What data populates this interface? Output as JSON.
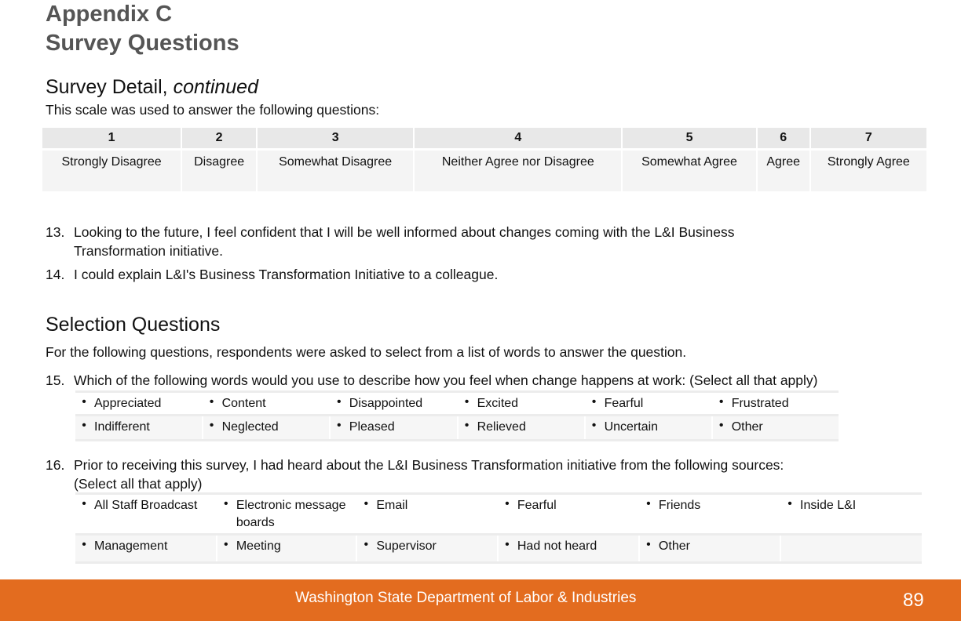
{
  "header": {
    "appendix": "Appendix C",
    "title": "Survey Questions"
  },
  "survey_detail": {
    "heading": "Survey Detail, ",
    "heading_italic": "continued",
    "intro": "This scale was used to answer the following questions:"
  },
  "scale": [
    {
      "value": "1",
      "label": "Strongly Disagree"
    },
    {
      "value": "2",
      "label": "Disagree"
    },
    {
      "value": "3",
      "label": "Somewhat Disagree"
    },
    {
      "value": "4",
      "label": "Neither Agree nor Disagree"
    },
    {
      "value": "5",
      "label": "Somewhat Agree"
    },
    {
      "value": "6",
      "label": "Agree"
    },
    {
      "value": "7",
      "label": "Strongly Agree"
    }
  ],
  "scaled_questions": [
    {
      "number": "13.",
      "line1": "Looking to the future, I feel confident that I will be well informed about changes coming with the L&I Business",
      "line2": "Transformation initiative."
    },
    {
      "number": "14.",
      "line1": "I could explain L&I's Business Transformation Initiative to a colleague."
    }
  ],
  "selection": {
    "heading": "Selection Questions",
    "intro": "For the following questions, respondents were asked to select from a list of words to answer the question.",
    "q15": {
      "number": "15.",
      "text": "Which of the following words would you use to describe how you feel when change happens at work: (Select all that apply)",
      "bullet": "•",
      "rows": [
        [
          "Appreciated",
          "Content",
          "Disappointed",
          "Excited",
          "Fearful",
          "Frustrated"
        ],
        [
          "Indifferent",
          "Neglected",
          "Pleased",
          "Relieved",
          "Uncertain",
          "Other"
        ]
      ]
    },
    "q16": {
      "number": "16.",
      "line1": "Prior to receiving this survey, I had heard about the L&I Business Transformation initiative from the following sources:",
      "line2": "(Select all that apply)",
      "bullet": "•",
      "rows": [
        [
          "All Staff Broadcast",
          "Electronic message boards",
          "Email",
          "Fearful",
          "Friends",
          "Inside L&I"
        ],
        [
          "Management",
          "Meeting",
          "Supervisor",
          "Had not heard",
          "Other",
          ""
        ]
      ]
    }
  },
  "footer": {
    "organization": "Washington State Department of Labor & Industries",
    "page_number": "89",
    "color": "#e36c1f"
  }
}
